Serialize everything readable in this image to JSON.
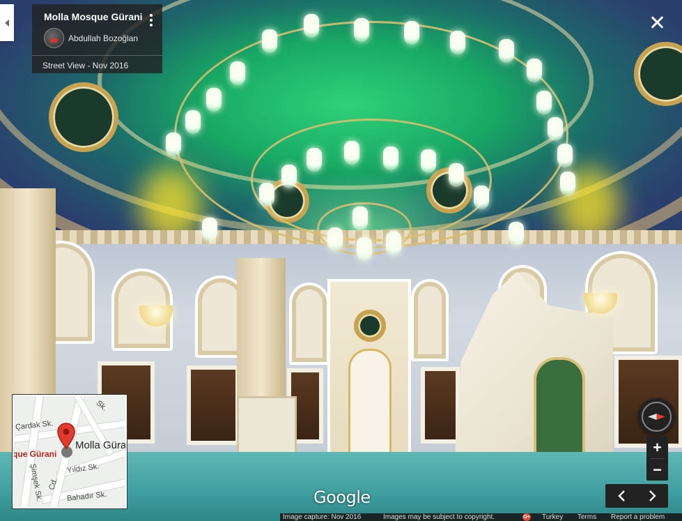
{
  "info_card": {
    "title": "Molla Mosque Gürani",
    "author": "Abdullah Bozoğlan",
    "date": "Street View - Nov 2016"
  },
  "minimap": {
    "streets": [
      "Çardak Sk.",
      "Yıldız Sk.",
      "Şimşek Sk.",
      "Bahadır Sk.",
      "Sk.",
      "Cd."
    ],
    "place_label": "Molla Güra",
    "place_label_left": "que Gürani"
  },
  "branding": {
    "logo": "Google"
  },
  "footer": {
    "capture": "Image capture: Nov 2016",
    "copyright": "Images may be subject to copyright.",
    "gplus": "G+",
    "country": "Turkey",
    "terms": "Terms",
    "report": "Report a problem"
  },
  "controls": {
    "zoom_in": "+",
    "zoom_out": "−"
  },
  "colors": {
    "card_bg": "#222222",
    "pin_red": "#e23b2e",
    "place_red": "#b3261e",
    "gplus_red": "#dd4b39"
  },
  "icons": [
    "collapse-arrow-icon",
    "more-vert-icon",
    "close-icon",
    "compass-icon",
    "map-pin-icon",
    "chevron-left-icon",
    "chevron-right-icon"
  ]
}
